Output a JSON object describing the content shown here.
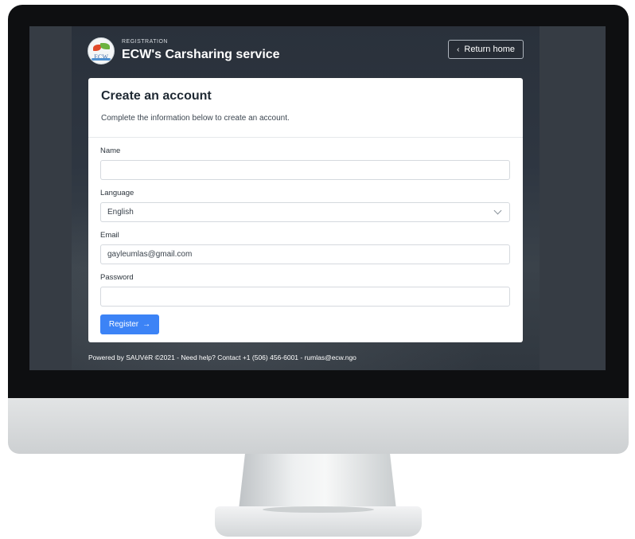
{
  "header": {
    "eyebrow": "REGISTRATION",
    "title": "ECW's Carsharing service",
    "logo_text": "ECW",
    "return_label": "Return home"
  },
  "card": {
    "title": "Create an account",
    "subtitle": "Complete the information below to create an account."
  },
  "form": {
    "name_label": "Name",
    "name_value": "",
    "language_label": "Language",
    "language_value": "English",
    "email_label": "Email",
    "email_value": "gayleumlas@gmail.com",
    "password_label": "Password",
    "password_value": "",
    "register_label": "Register"
  },
  "footer": {
    "text": "Powered by SAUVéR ©2021 - Need help? Contact +1 (506) 456-6001 - rumlas@ecw.ngo"
  },
  "colors": {
    "accent": "#3c83f6",
    "header_bg": "#2a313b",
    "card_bg": "#ffffff"
  }
}
